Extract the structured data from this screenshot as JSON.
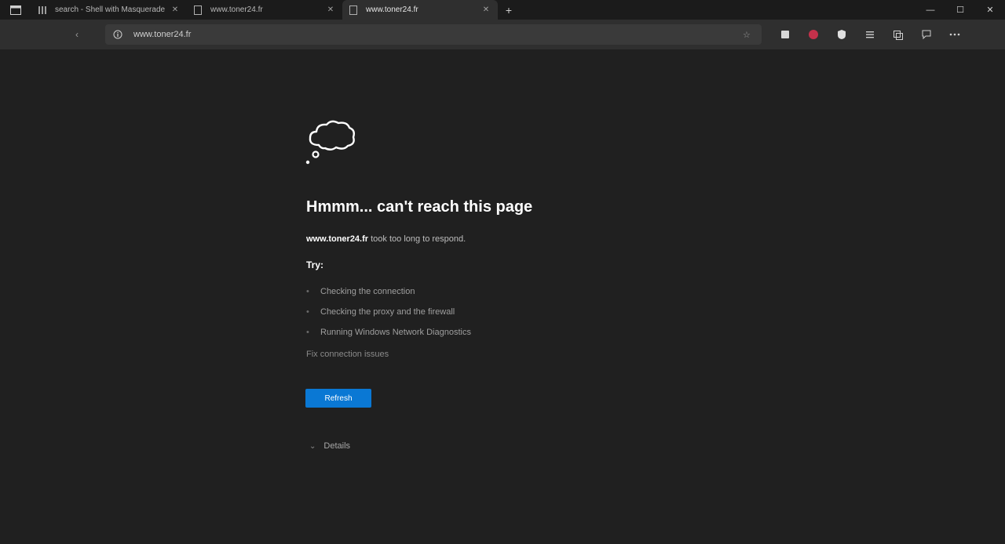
{
  "tabs": [
    {
      "title": "search - Shell with Masquerade",
      "icon": "books-icon",
      "active": false
    },
    {
      "title": "www.toner24.fr",
      "icon": "page-icon",
      "active": false
    },
    {
      "title": "www.toner24.fr",
      "icon": "page-icon",
      "active": true
    }
  ],
  "new_tab_label": "+",
  "window_controls": {
    "minimize": "—",
    "maximize": "☐",
    "close": "✕"
  },
  "toolbar": {
    "back_label": "‹",
    "url": "www.toner24.fr",
    "star": "☆"
  },
  "error": {
    "heading": "Hmmm... can't reach this page",
    "host": "www.toner24.fr",
    "message": " took too long to respond.",
    "try_label": "Try:",
    "suggestions": [
      "Checking the connection",
      "Checking the proxy and the firewall",
      "Running Windows Network Diagnostics"
    ],
    "fix_link": "Fix connection issues",
    "refresh_label": "Refresh",
    "details_label": "Details"
  },
  "colors": {
    "background": "#202020",
    "toolbar": "#2f2f2f",
    "accent": "#0a78d4"
  }
}
